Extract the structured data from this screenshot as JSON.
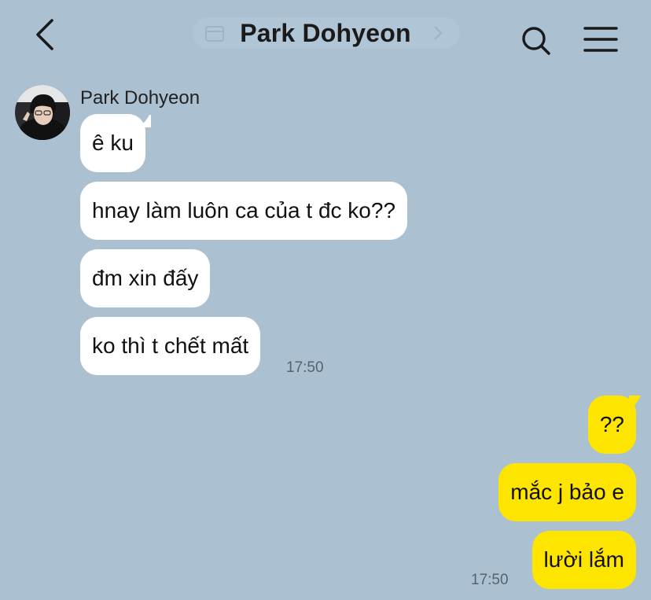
{
  "header": {
    "title": "Park Dohyeon",
    "back_icon": "chevron-left-icon",
    "search_icon": "search-icon",
    "menu_icon": "hamburger-menu-icon"
  },
  "colors": {
    "background": "#abc1d2",
    "incoming_bubble": "#ffffff",
    "outgoing_bubble": "#fee500"
  },
  "conversation": {
    "incoming": {
      "sender": "Park Dohyeon",
      "messages": [
        {
          "text": "ê ku"
        },
        {
          "text": "hnay làm luôn ca của t đc ko??"
        },
        {
          "text": "đm xin đấy"
        },
        {
          "text": "ko thì t chết mất"
        }
      ],
      "time": "17:50"
    },
    "outgoing": {
      "messages": [
        {
          "text": "??"
        },
        {
          "text": "mắc j bảo e"
        },
        {
          "text": "lười lắm"
        }
      ],
      "time": "17:50"
    }
  }
}
